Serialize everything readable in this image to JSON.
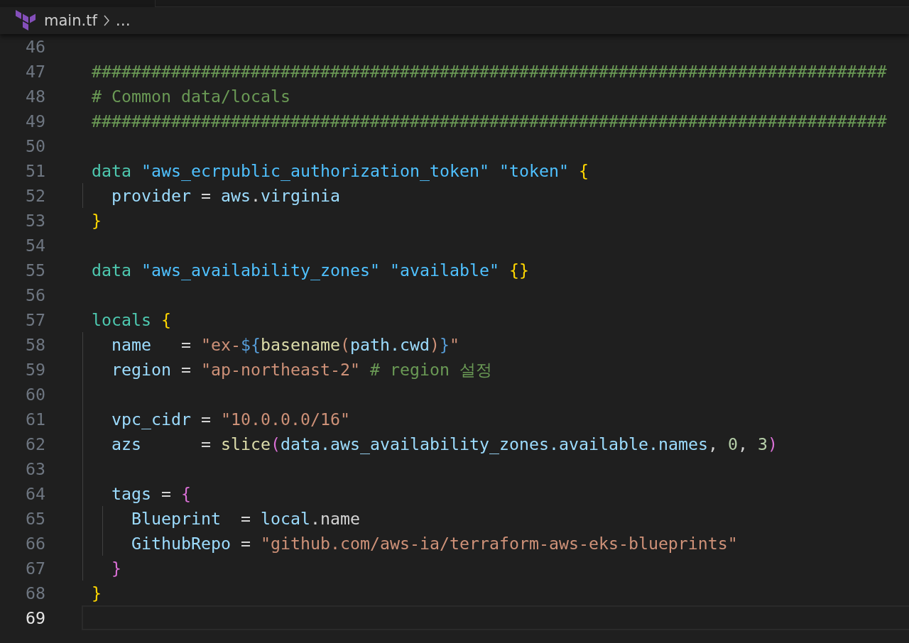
{
  "breadcrumb": {
    "file": "main.tf",
    "more": "…"
  },
  "lines": [
    {
      "number": "46",
      "active": false
    },
    {
      "number": "47",
      "active": false,
      "tokens": [
        {
          "text": "################################################################################",
          "kind": "comment"
        }
      ]
    },
    {
      "number": "48",
      "active": false,
      "tokens": [
        {
          "text": "# Common data/locals",
          "kind": "comment"
        }
      ]
    },
    {
      "number": "49",
      "active": false,
      "tokens": [
        {
          "text": "################################################################################",
          "kind": "comment"
        }
      ]
    },
    {
      "number": "50",
      "active": false
    },
    {
      "number": "51",
      "active": false,
      "tokens": [
        {
          "text": "data ",
          "kind": "keyword"
        },
        {
          "text": "\"aws_ecrpublic_authorization_token\" \"token\" ",
          "kind": "label"
        },
        {
          "text": "{",
          "kind": "brace1"
        }
      ]
    },
    {
      "number": "52",
      "active": false,
      "tokens": [
        {
          "text": "  provider",
          "kind": "attr"
        },
        {
          "text": " = ",
          "kind": "plain"
        },
        {
          "text": "aws",
          "kind": "attr"
        },
        {
          "text": ".",
          "kind": "plain"
        },
        {
          "text": "virginia",
          "kind": "attr"
        }
      ]
    },
    {
      "number": "53",
      "active": false,
      "tokens": [
        {
          "text": "}",
          "kind": "brace1"
        }
      ]
    },
    {
      "number": "54",
      "active": false
    },
    {
      "number": "55",
      "active": false,
      "tokens": [
        {
          "text": "data ",
          "kind": "keyword"
        },
        {
          "text": "\"aws_availability_zones\" \"available\" ",
          "kind": "label"
        },
        {
          "text": "{}",
          "kind": "brace1"
        }
      ]
    },
    {
      "number": "56",
      "active": false
    },
    {
      "number": "57",
      "active": false,
      "tokens": [
        {
          "text": "locals ",
          "kind": "keyword"
        },
        {
          "text": "{",
          "kind": "brace1"
        }
      ]
    },
    {
      "number": "58",
      "active": false,
      "tokens": [
        {
          "text": "  name",
          "kind": "attr"
        },
        {
          "text": "   = ",
          "kind": "plain"
        },
        {
          "text": "\"ex-",
          "kind": "string"
        },
        {
          "text": "${",
          "kind": "brace3"
        },
        {
          "text": "basename",
          "kind": "func"
        },
        {
          "text": "(",
          "kind": "string"
        },
        {
          "text": "path.cwd",
          "kind": "attr"
        },
        {
          "text": ")",
          "kind": "string"
        },
        {
          "text": "}",
          "kind": "brace3"
        },
        {
          "text": "\"",
          "kind": "string"
        }
      ]
    },
    {
      "number": "59",
      "active": false,
      "tokens": [
        {
          "text": "  region",
          "kind": "attr"
        },
        {
          "text": " = ",
          "kind": "plain"
        },
        {
          "text": "\"ap-northeast-2\" ",
          "kind": "string"
        },
        {
          "text": "# region 설정",
          "kind": "comment"
        }
      ]
    },
    {
      "number": "60",
      "active": false
    },
    {
      "number": "61",
      "active": false,
      "tokens": [
        {
          "text": "  vpc_cidr",
          "kind": "attr"
        },
        {
          "text": " = ",
          "kind": "plain"
        },
        {
          "text": "\"10.0.0.0/16\"",
          "kind": "string"
        }
      ]
    },
    {
      "number": "62",
      "active": false,
      "tokens": [
        {
          "text": "  azs",
          "kind": "attr"
        },
        {
          "text": "      = ",
          "kind": "plain"
        },
        {
          "text": "slice",
          "kind": "func"
        },
        {
          "text": "(",
          "kind": "brace2"
        },
        {
          "text": "data.aws_availability_zones.available.names",
          "kind": "attr"
        },
        {
          "text": ", ",
          "kind": "plain"
        },
        {
          "text": "0",
          "kind": "number"
        },
        {
          "text": ", ",
          "kind": "plain"
        },
        {
          "text": "3",
          "kind": "number"
        },
        {
          "text": ")",
          "kind": "brace2"
        }
      ]
    },
    {
      "number": "63",
      "active": false
    },
    {
      "number": "64",
      "active": false,
      "tokens": [
        {
          "text": "  tags",
          "kind": "attr"
        },
        {
          "text": " = ",
          "kind": "plain"
        },
        {
          "text": "{",
          "kind": "brace2"
        }
      ]
    },
    {
      "number": "65",
      "active": false,
      "tokens": [
        {
          "text": "    Blueprint",
          "kind": "attr"
        },
        {
          "text": "  = ",
          "kind": "plain"
        },
        {
          "text": "local",
          "kind": "attr"
        },
        {
          "text": ".name",
          "kind": "plain"
        }
      ]
    },
    {
      "number": "66",
      "active": false,
      "tokens": [
        {
          "text": "    GithubRepo",
          "kind": "attr"
        },
        {
          "text": " = ",
          "kind": "plain"
        },
        {
          "text": "\"github.com/aws-ia/terraform-aws-eks-blueprints\"",
          "kind": "string"
        }
      ]
    },
    {
      "number": "67",
      "active": false,
      "tokens": [
        {
          "text": "  }",
          "kind": "brace2"
        }
      ]
    },
    {
      "number": "68",
      "active": false,
      "tokens": [
        {
          "text": "}",
          "kind": "brace1"
        }
      ]
    },
    {
      "number": "69",
      "active": true
    }
  ]
}
